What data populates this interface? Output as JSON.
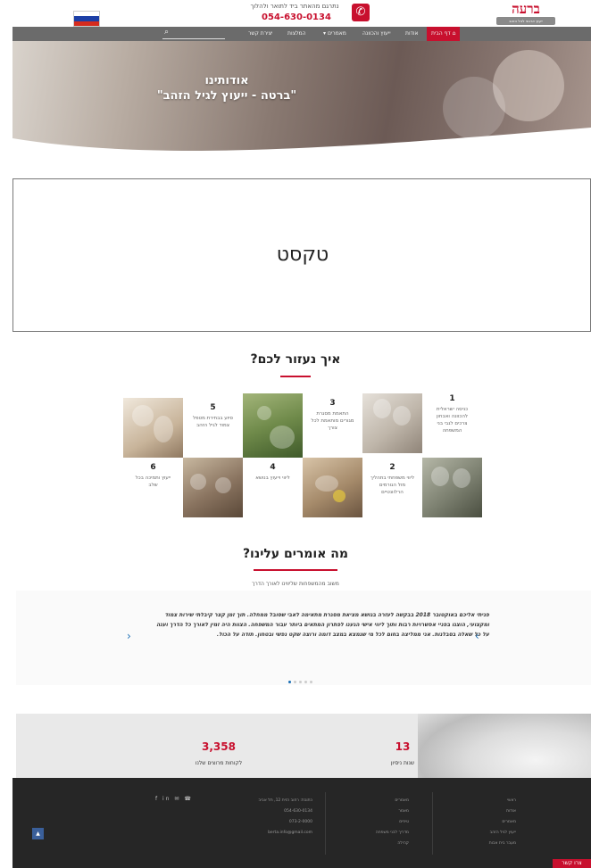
{
  "topbar": {
    "note": "נתרגם מהאתר ביד לתואר ולהלוך",
    "phone": "054-630-0134",
    "logo_text": "ברעה",
    "logo_sub": "ייעוץ ארגוני לגיל הזהב"
  },
  "nav": {
    "items": [
      "דף הבית",
      "אודות",
      "ייעוץ והכוונה",
      "מאמרים",
      "המלצות",
      "יצירת קשר"
    ],
    "menu_arrow": "▾",
    "search_icon": "⌕"
  },
  "hero": {
    "title": "אודותינו",
    "subtitle": "\"ברטה - ייעוץ לגיל הזהב\""
  },
  "textbox": {
    "text": "טקסט"
  },
  "help": {
    "title": "איך נעזור לכם?",
    "items": [
      {
        "num": "1",
        "desc": "כניסה ישראלית להכוונה ואבחון צרכים לגבי בני המשפחה"
      },
      {
        "num": "2",
        "desc": "ליווי משפחתי בתהליך מול הגורמים הרלוונטיים"
      },
      {
        "num": "3",
        "desc": "התאמת מסגרת מגורים מותאמת לכל צורך"
      },
      {
        "num": "4",
        "desc": "ליווי וייעוץ בנושא"
      },
      {
        "num": "5",
        "desc": "סיוע בבחירת מטפל צמוד לגיל הזהב"
      },
      {
        "num": "6",
        "desc": "ייעוץ ותמיכה בכל שלב"
      }
    ]
  },
  "testimonials": {
    "title": "מה אומרים עלינו?",
    "subtitle": "משוב מהמשפחות שליווינו לאורך הדרך",
    "quote": "פניתי אליכם באוקטובר 2018 בבקשה לעזרה בנושא מציאת מסגרת מתאימה לאבי שסובל ממחלה. תוך זמן קצר קיבלתי שירות צמוד ומקצועי, הוצגו בפניי אפשרויות רבות ותוך ליווי אישי הגענו לפתרון המתאים ביותר עבור המשפחה. הצוות היה זמין לאורך כל הדרך וענה על כל שאלה בסבלנות. אני ממליצה בחום לכל מי שנמצא במצב דומה ורוצה שקט נפשי ובטחון. תודה על הכול.",
    "prev_icon": "‹",
    "next_icon": "›"
  },
  "stats": [
    {
      "num": "13",
      "label": "שנות ניסיון"
    },
    {
      "num": "3,358",
      "label": "לקוחות מרוצים שלנו"
    }
  ],
  "footer": {
    "col1": [
      "ראשי",
      "אודות",
      "מאמרים",
      "ייעוץ לגיל הזהב",
      "מעבר בית אבות"
    ],
    "col2": [
      "מאמרים",
      "מאמר",
      "טיפים",
      "מדריך לבני משפחה",
      "קהילה"
    ],
    "col3": [
      "כתובת: רחוב הזית 12, תל אביב",
      "054-630-0134",
      "073-2-0000",
      "berta.info@gmail.com"
    ],
    "social": "f  in  ✉  ☎",
    "totop_icon": "▲"
  },
  "contact_button": "צרו קשר",
  "colors": {
    "brand_red": "#c8102e",
    "nav_gray": "#6b6b6b",
    "footer_dark": "#262626"
  }
}
